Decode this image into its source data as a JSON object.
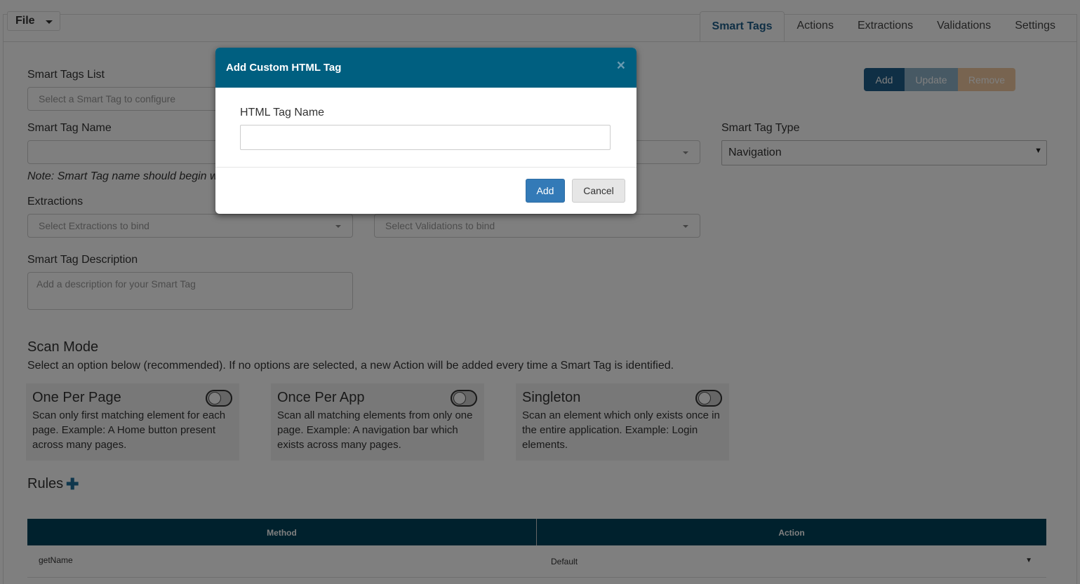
{
  "menu": {
    "file_label": "File"
  },
  "tabs": [
    {
      "label": "Smart Tags",
      "active": true
    },
    {
      "label": "Actions"
    },
    {
      "label": "Extractions"
    },
    {
      "label": "Validations"
    },
    {
      "label": "Settings"
    }
  ],
  "form": {
    "list_label": "Smart Tags List",
    "list_placeholder": "Select a Smart Tag to configure",
    "name_label": "Smart Tag Name",
    "name_value": "",
    "note": "Note: Smart Tag name should begin w",
    "type_label": "Smart Tag Type",
    "type_value": "Navigation",
    "extractions_label": "Extractions",
    "extractions_placeholder": "Select Extractions to bind",
    "validations_placeholder": "Select Validations to bind",
    "description_label": "Smart Tag Description",
    "description_placeholder": "Add a description for your Smart Tag"
  },
  "buttons": {
    "add": "Add",
    "update": "Update",
    "remove": "Remove"
  },
  "scan_mode": {
    "title": "Scan Mode",
    "description": "Select an option below (recommended). If no options are selected, a new Action will be added every time a Smart Tag is identified.",
    "options": [
      {
        "title": "One Per Page",
        "text": "Scan only first matching element for each page. Example: A Home button present across many pages.",
        "enabled": false
      },
      {
        "title": "Once Per App",
        "text": "Scan all matching elements from only one page. Example: A navigation bar which exists across many pages.",
        "enabled": false
      },
      {
        "title": "Singleton",
        "text": "Scan an element which only exists once in the entire application. Example: Login elements.",
        "enabled": false
      }
    ]
  },
  "rules": {
    "title": "Rules",
    "columns": [
      "Method",
      "Action"
    ],
    "rows": [
      {
        "method": "getName",
        "action": "Default"
      }
    ]
  },
  "modal": {
    "title": "Add Custom HTML Tag",
    "close_glyph": "×",
    "field_label": "HTML Tag Name",
    "field_value": "",
    "add_label": "Add",
    "cancel_label": "Cancel"
  },
  "colors": {
    "header_bg": "#005f80",
    "table_head_bg": "#00425a",
    "primary": "#337ab7"
  }
}
